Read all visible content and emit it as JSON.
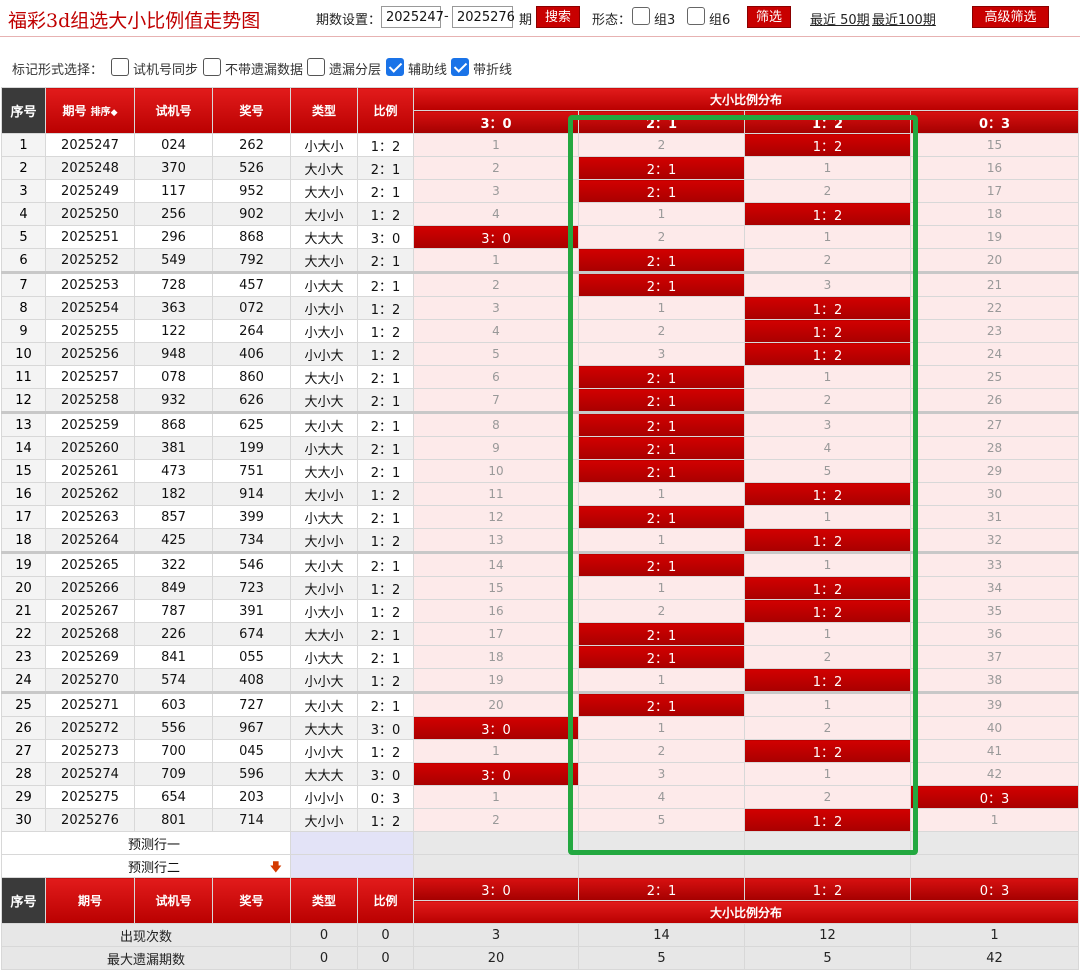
{
  "header": {
    "title": "福彩3d组选大小比例值走势图",
    "period_label": "期数设置：",
    "period_start": "2025247",
    "period_dash": "-",
    "period_end": "2025276",
    "period_unit": "期",
    "search_button": "搜索",
    "shape_label": "形态：",
    "group3_label": "组3",
    "group6_label": "组6",
    "filter_button": "筛选",
    "recent50": "最近 50期",
    "recent100": "最近100期",
    "advanced_button": "高级筛选"
  },
  "options": {
    "label": "标记形式选择：",
    "items": [
      {
        "label": "试机号同步",
        "checked": false
      },
      {
        "label": "不带遗漏数据",
        "checked": false
      },
      {
        "label": "遗漏分层",
        "checked": false
      },
      {
        "label": "辅助线",
        "checked": true
      },
      {
        "label": "带折线",
        "checked": true
      }
    ]
  },
  "table": {
    "col_seq": "序号",
    "col_issue": "期号",
    "col_sort": "排序",
    "col_trial": "试机号",
    "col_prize": "奖号",
    "col_type": "类型",
    "col_ratio": "比例",
    "dist_header": "大小比例分布",
    "ratio_cols": [
      "3：0",
      "2：1",
      "1：2",
      "0：3"
    ],
    "rows": [
      {
        "seq": "1",
        "issue": "2025247",
        "trial": "024",
        "prize": "262",
        "type": "小大小",
        "ratio": "1：2",
        "cells": [
          "1",
          "2",
          "1：2",
          "15"
        ],
        "hit": 2
      },
      {
        "seq": "2",
        "issue": "2025248",
        "trial": "370",
        "prize": "526",
        "type": "大小大",
        "ratio": "2：1",
        "cells": [
          "2",
          "2：1",
          "1",
          "16"
        ],
        "hit": 1
      },
      {
        "seq": "3",
        "issue": "2025249",
        "trial": "117",
        "prize": "952",
        "type": "大大小",
        "ratio": "2：1",
        "cells": [
          "3",
          "2：1",
          "2",
          "17"
        ],
        "hit": 1
      },
      {
        "seq": "4",
        "issue": "2025250",
        "trial": "256",
        "prize": "902",
        "type": "大小小",
        "ratio": "1：2",
        "cells": [
          "4",
          "1",
          "1：2",
          "18"
        ],
        "hit": 2
      },
      {
        "seq": "5",
        "issue": "2025251",
        "trial": "296",
        "prize": "868",
        "type": "大大大",
        "ratio": "3：0",
        "cells": [
          "3：0",
          "2",
          "1",
          "19"
        ],
        "hit": 0
      },
      {
        "seq": "6",
        "issue": "2025252",
        "trial": "549",
        "prize": "792",
        "type": "大大小",
        "ratio": "2：1",
        "cells": [
          "1",
          "2：1",
          "2",
          "20"
        ],
        "hit": 1
      },
      {
        "seq": "7",
        "issue": "2025253",
        "trial": "728",
        "prize": "457",
        "type": "小大大",
        "ratio": "2：1",
        "cells": [
          "2",
          "2：1",
          "3",
          "21"
        ],
        "hit": 1
      },
      {
        "seq": "8",
        "issue": "2025254",
        "trial": "363",
        "prize": "072",
        "type": "小大小",
        "ratio": "1：2",
        "cells": [
          "3",
          "1",
          "1：2",
          "22"
        ],
        "hit": 2
      },
      {
        "seq": "9",
        "issue": "2025255",
        "trial": "122",
        "prize": "264",
        "type": "小大小",
        "ratio": "1：2",
        "cells": [
          "4",
          "2",
          "1：2",
          "23"
        ],
        "hit": 2
      },
      {
        "seq": "10",
        "issue": "2025256",
        "trial": "948",
        "prize": "406",
        "type": "小小大",
        "ratio": "1：2",
        "cells": [
          "5",
          "3",
          "1：2",
          "24"
        ],
        "hit": 2
      },
      {
        "seq": "11",
        "issue": "2025257",
        "trial": "078",
        "prize": "860",
        "type": "大大小",
        "ratio": "2：1",
        "cells": [
          "6",
          "2：1",
          "1",
          "25"
        ],
        "hit": 1
      },
      {
        "seq": "12",
        "issue": "2025258",
        "trial": "932",
        "prize": "626",
        "type": "大小大",
        "ratio": "2：1",
        "cells": [
          "7",
          "2：1",
          "2",
          "26"
        ],
        "hit": 1
      },
      {
        "seq": "13",
        "issue": "2025259",
        "trial": "868",
        "prize": "625",
        "type": "大小大",
        "ratio": "2：1",
        "cells": [
          "8",
          "2：1",
          "3",
          "27"
        ],
        "hit": 1
      },
      {
        "seq": "14",
        "issue": "2025260",
        "trial": "381",
        "prize": "199",
        "type": "小大大",
        "ratio": "2：1",
        "cells": [
          "9",
          "2：1",
          "4",
          "28"
        ],
        "hit": 1
      },
      {
        "seq": "15",
        "issue": "2025261",
        "trial": "473",
        "prize": "751",
        "type": "大大小",
        "ratio": "2：1",
        "cells": [
          "10",
          "2：1",
          "5",
          "29"
        ],
        "hit": 1
      },
      {
        "seq": "16",
        "issue": "2025262",
        "trial": "182",
        "prize": "914",
        "type": "大小小",
        "ratio": "1：2",
        "cells": [
          "11",
          "1",
          "1：2",
          "30"
        ],
        "hit": 2
      },
      {
        "seq": "17",
        "issue": "2025263",
        "trial": "857",
        "prize": "399",
        "type": "小大大",
        "ratio": "2：1",
        "cells": [
          "12",
          "2：1",
          "1",
          "31"
        ],
        "hit": 1
      },
      {
        "seq": "18",
        "issue": "2025264",
        "trial": "425",
        "prize": "734",
        "type": "大小小",
        "ratio": "1：2",
        "cells": [
          "13",
          "1",
          "1：2",
          "32"
        ],
        "hit": 2
      },
      {
        "seq": "19",
        "issue": "2025265",
        "trial": "322",
        "prize": "546",
        "type": "大小大",
        "ratio": "2：1",
        "cells": [
          "14",
          "2：1",
          "1",
          "33"
        ],
        "hit": 1
      },
      {
        "seq": "20",
        "issue": "2025266",
        "trial": "849",
        "prize": "723",
        "type": "大小小",
        "ratio": "1：2",
        "cells": [
          "15",
          "1",
          "1：2",
          "34"
        ],
        "hit": 2
      },
      {
        "seq": "21",
        "issue": "2025267",
        "trial": "787",
        "prize": "391",
        "type": "小大小",
        "ratio": "1：2",
        "cells": [
          "16",
          "2",
          "1：2",
          "35"
        ],
        "hit": 2
      },
      {
        "seq": "22",
        "issue": "2025268",
        "trial": "226",
        "prize": "674",
        "type": "大大小",
        "ratio": "2：1",
        "cells": [
          "17",
          "2：1",
          "1",
          "36"
        ],
        "hit": 1
      },
      {
        "seq": "23",
        "issue": "2025269",
        "trial": "841",
        "prize": "055",
        "type": "小大大",
        "ratio": "2：1",
        "cells": [
          "18",
          "2：1",
          "2",
          "37"
        ],
        "hit": 1
      },
      {
        "seq": "24",
        "issue": "2025270",
        "trial": "574",
        "prize": "408",
        "type": "小小大",
        "ratio": "1：2",
        "cells": [
          "19",
          "1",
          "1：2",
          "38"
        ],
        "hit": 2
      },
      {
        "seq": "25",
        "issue": "2025271",
        "trial": "603",
        "prize": "727",
        "type": "大小大",
        "ratio": "2：1",
        "cells": [
          "20",
          "2：1",
          "1",
          "39"
        ],
        "hit": 1
      },
      {
        "seq": "26",
        "issue": "2025272",
        "trial": "556",
        "prize": "967",
        "type": "大大大",
        "ratio": "3：0",
        "cells": [
          "3：0",
          "1",
          "2",
          "40"
        ],
        "hit": 0
      },
      {
        "seq": "27",
        "issue": "2025273",
        "trial": "700",
        "prize": "045",
        "type": "小小大",
        "ratio": "1：2",
        "cells": [
          "1",
          "2",
          "1：2",
          "41"
        ],
        "hit": 2
      },
      {
        "seq": "28",
        "issue": "2025274",
        "trial": "709",
        "prize": "596",
        "type": "大大大",
        "ratio": "3：0",
        "cells": [
          "3：0",
          "3",
          "1",
          "42"
        ],
        "hit": 0
      },
      {
        "seq": "29",
        "issue": "2025275",
        "trial": "654",
        "prize": "203",
        "type": "小小小",
        "ratio": "0：3",
        "cells": [
          "1",
          "4",
          "2",
          "0：3"
        ],
        "hit": 3
      },
      {
        "seq": "30",
        "issue": "2025276",
        "trial": "801",
        "prize": "714",
        "type": "大小小",
        "ratio": "1：2",
        "cells": [
          "2",
          "5",
          "1：2",
          "1"
        ],
        "hit": 2
      }
    ],
    "predict1": "预测行一",
    "predict2": "预测行二",
    "stats": [
      {
        "label": "出现次数",
        "type": "0",
        "ratio": "0",
        "vals": [
          "3",
          "14",
          "12",
          "1"
        ]
      },
      {
        "label": "最大遗漏期数",
        "type": "0",
        "ratio": "0",
        "vals": [
          "20",
          "5",
          "5",
          "42"
        ]
      }
    ]
  },
  "colors": {
    "accent_red": "#c80000",
    "highlight_green": "#23a840",
    "check_blue": "#1a73e8"
  }
}
